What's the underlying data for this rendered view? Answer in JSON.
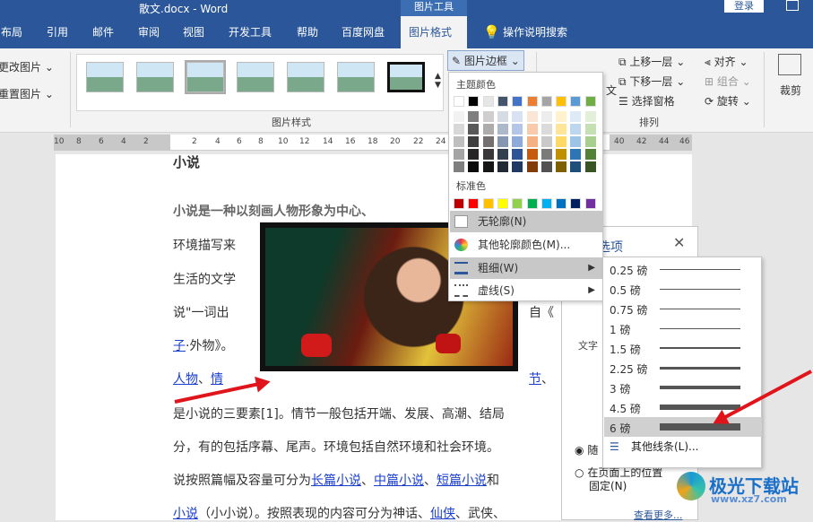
{
  "titlebar": {
    "doc_title": "散文.docx - Word",
    "context_tab": "图片工具",
    "login": "登录"
  },
  "tabs": [
    {
      "label": "布局"
    },
    {
      "label": "引用"
    },
    {
      "label": "邮件"
    },
    {
      "label": "审阅"
    },
    {
      "label": "视图"
    },
    {
      "label": "开发工具"
    },
    {
      "label": "帮助"
    },
    {
      "label": "百度网盘"
    },
    {
      "label": "图片格式"
    },
    {
      "label": "操作说明搜索"
    }
  ],
  "ribbon": {
    "change_picture": "更改图片",
    "reset_picture": "重置图片",
    "picture_styles_label": "图片样式",
    "picture_border": "图片边框",
    "wen": "文",
    "bring_forward": "上移一层",
    "send_backward": "下移一层",
    "selection_pane": "选择窗格",
    "align": "对齐",
    "group": "组合",
    "rotate": "旋转",
    "arrange_label": "排列",
    "crop": "裁剪"
  },
  "ruler": {
    "ticks": [
      "10",
      "8",
      "6",
      "4",
      "2",
      "2",
      "4",
      "6",
      "8",
      "10",
      "12",
      "14",
      "16",
      "18",
      "20",
      "22",
      "24",
      "40",
      "42",
      "44",
      "46"
    ]
  },
  "document": {
    "heading": "小说",
    "line1_bold": "小说是一种以刻画人物形象为中心、",
    "line2": "环境描写来",
    "line3": "生活的文学",
    "line4a": "说\"一词出",
    "line4b": "自《",
    "line5_link": "子",
    "line5": "·外物》。",
    "line6_link1": "人物",
    "line6_sep": "、",
    "line6_link2": "情",
    "line6_link3": "节",
    "line6_tail": "、",
    "line7": "是小说的三要素[1]。情节一般包括开端、发展、高潮、结局",
    "line8": "分，有的包括序幕、尾声。环境包括自然环境和社会环境。",
    "line9a": "说按照篇幅及容量可分为",
    "line9_link1": "长篇小说",
    "line9_sep1": "、",
    "line9_link2": "中篇小说",
    "line9_sep2": "、",
    "line9_link3": "短篇小说",
    "line9b": "和",
    "line10_link1": "小说",
    "line10a": "（小小说）。按照表现的内容可分为神话、",
    "line10_link2": "仙侠",
    "line10b": "、武侠、"
  },
  "border_menu": {
    "theme_colors_label": "主题颜色",
    "standard_colors_label": "标准色",
    "theme_top": [
      "#ffffff",
      "#000000",
      "#e7e6e6",
      "#44546a",
      "#4472c4",
      "#ed7d31",
      "#a5a5a5",
      "#ffc000",
      "#5b9bd5",
      "#70ad47"
    ],
    "theme_shades": [
      [
        "#f2f2f2",
        "#7f7f7f",
        "#d0cece",
        "#d6dce4",
        "#d9e2f3",
        "#fbe5d5",
        "#ededed",
        "#fff2cc",
        "#deebf6",
        "#e2efd9"
      ],
      [
        "#d8d8d8",
        "#595959",
        "#aeabab",
        "#adb9ca",
        "#b4c6e7",
        "#f7cbac",
        "#dbdbdb",
        "#fee599",
        "#bdd7ee",
        "#c5e0b3"
      ],
      [
        "#bfbfbf",
        "#3f3f3f",
        "#757070",
        "#8496b0",
        "#8eaadb",
        "#f4b183",
        "#c9c9c9",
        "#ffd965",
        "#9dc3e6",
        "#a8d08d"
      ],
      [
        "#a5a5a5",
        "#262626",
        "#3a3838",
        "#323f4f",
        "#2f5496",
        "#c55a11",
        "#7b7b7b",
        "#bf9000",
        "#2e75b5",
        "#538135"
      ],
      [
        "#7f7f7f",
        "#0c0c0c",
        "#171616",
        "#222a35",
        "#1f3864",
        "#833c0b",
        "#525252",
        "#7f6000",
        "#1e4e79",
        "#375623"
      ]
    ],
    "standard": [
      "#c00000",
      "#ff0000",
      "#ffc000",
      "#ffff00",
      "#92d050",
      "#00b050",
      "#00b0f0",
      "#0070c0",
      "#002060",
      "#7030a0"
    ],
    "no_outline": "无轮廓(N)",
    "more_colors": "其他轮廓颜色(M)...",
    "weight": "粗细(W)",
    "dashes": "虚线(S)"
  },
  "weight_submenu": {
    "items": [
      {
        "label": "0.25 磅",
        "pt": 0.25
      },
      {
        "label": "0.5 磅",
        "pt": 0.5
      },
      {
        "label": "0.75 磅",
        "pt": 0.75
      },
      {
        "label": "1 磅",
        "pt": 1
      },
      {
        "label": "1.5 磅",
        "pt": 1.5
      },
      {
        "label": "2.25 磅",
        "pt": 2.25
      },
      {
        "label": "3 磅",
        "pt": 3
      },
      {
        "label": "4.5 磅",
        "pt": 4.5
      },
      {
        "label": "6 磅",
        "pt": 6
      }
    ],
    "selected": "6 磅",
    "more_lines": "其他线条(L)..."
  },
  "side_pane": {
    "title": "选项",
    "section": "文字",
    "radio1": "随",
    "radio2_line1": "在页面上的位置",
    "radio2_line2": "固定(N)",
    "see_more": "查看更多..."
  },
  "watermark": {
    "text": "极光下载站",
    "sub": "www.xz7.com"
  }
}
